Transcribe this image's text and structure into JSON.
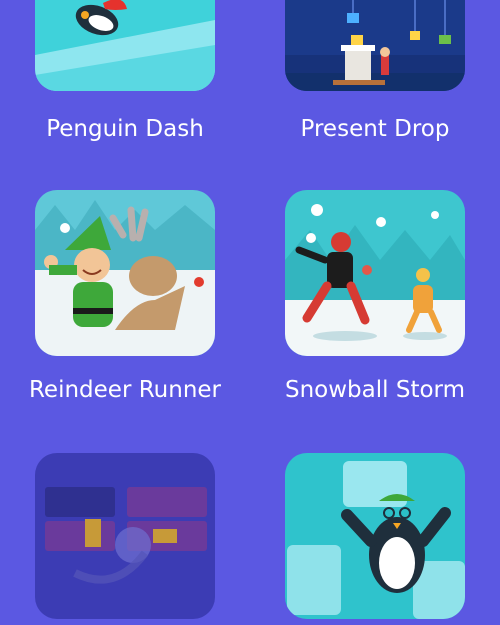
{
  "games": [
    {
      "title": "Penguin Dash",
      "locked": false
    },
    {
      "title": "Present Drop",
      "locked": false
    },
    {
      "title": "Reindeer Runner",
      "locked": false
    },
    {
      "title": "Snowball Storm",
      "locked": false
    },
    {
      "title": "",
      "locked": true
    },
    {
      "title": "",
      "locked": false
    }
  ],
  "colors": {
    "background": "#5b58e2",
    "label_text": "#ffffff",
    "locked_overlay": "#3c3cb4"
  }
}
